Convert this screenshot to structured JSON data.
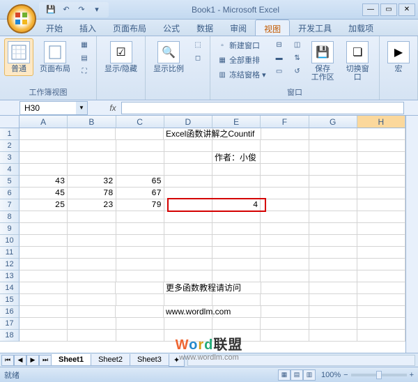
{
  "title": "Book1 - Microsoft Excel",
  "qat": {
    "save": "💾",
    "undo": "↶",
    "redo": "↷"
  },
  "tabs": [
    "开始",
    "插入",
    "页面布局",
    "公式",
    "数据",
    "审阅",
    "视图",
    "开发工具",
    "加载项"
  ],
  "active_tab": 6,
  "ribbon": {
    "group1": {
      "normal": "普通",
      "layout": "页面布局",
      "label": "工作簿视图"
    },
    "group2": {
      "showhide": "显示/隐藏"
    },
    "group3": {
      "zoomratio": "显示比例"
    },
    "group4": {
      "newwin": "新建窗口",
      "arrange": "全部重排",
      "freeze": "冻结窗格",
      "save_ws": "保存\n工作区",
      "switch": "切换窗口",
      "label": "窗口"
    },
    "group5": {
      "macro": "宏"
    }
  },
  "namebox": "H30",
  "fx": "fx",
  "cols": [
    "A",
    "B",
    "C",
    "D",
    "E",
    "F",
    "G",
    "H"
  ],
  "rows": [
    "1",
    "2",
    "3",
    "4",
    "5",
    "6",
    "7",
    "8",
    "9",
    "10",
    "11",
    "12",
    "13",
    "14",
    "15",
    "16",
    "17",
    "18"
  ],
  "cells": {
    "title_text": "Excel函数讲解之Countif",
    "author": "作者：小俊",
    "a5": "43",
    "b5": "32",
    "c5": "65",
    "a6": "45",
    "b6": "78",
    "c6": "67",
    "a7": "25",
    "b7": "23",
    "c7": "79",
    "e7": "4",
    "more_text": "更多函数教程请访问",
    "url": "www.wordlm.com"
  },
  "sheets": [
    "Sheet1",
    "Sheet2",
    "Sheet3"
  ],
  "status": {
    "ready": "就绪",
    "zoom": "100%"
  },
  "watermark": {
    "brand": "Word联盟",
    "url": "www.wordlm.com"
  },
  "chart_data": {
    "type": "table",
    "title": "Excel函数讲解之Countif",
    "data": [
      [
        43,
        32,
        65
      ],
      [
        45,
        78,
        67
      ],
      [
        25,
        23,
        79
      ]
    ],
    "result": 4
  }
}
